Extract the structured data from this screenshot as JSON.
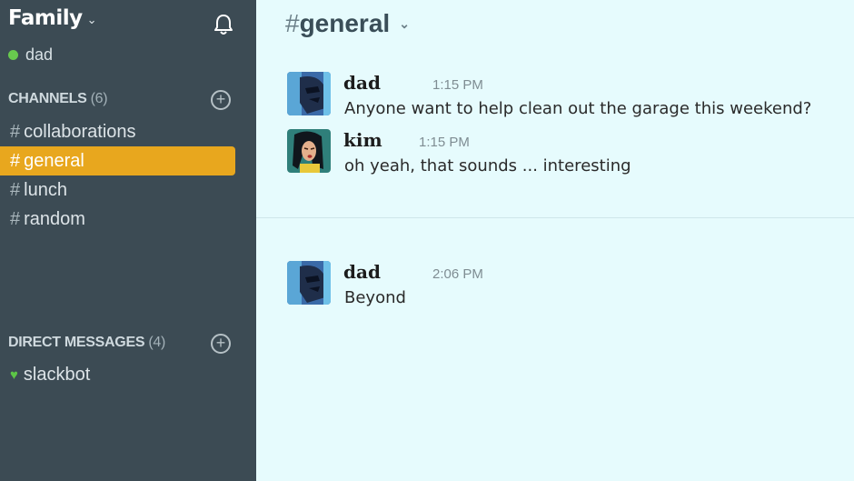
{
  "team": {
    "name": "Family",
    "chevron": "⌄"
  },
  "user": {
    "name": "dad",
    "status_color": "#68c94e"
  },
  "channels": {
    "heading": "CHANNELS",
    "count": "(6)",
    "items": [
      {
        "hash": "#",
        "label": "collaborations"
      },
      {
        "hash": "#",
        "label": "general",
        "active": true
      },
      {
        "hash": "#",
        "label": "lunch"
      },
      {
        "hash": "#",
        "label": "random"
      }
    ]
  },
  "direct_messages": {
    "heading": "DIRECT MESSAGES",
    "count": "(4)",
    "items": [
      {
        "icon": "heart-icon",
        "label": "slackbot"
      }
    ]
  },
  "main": {
    "channel_hash": "#",
    "channel_name": "general",
    "chevron": "⌄",
    "messages": [
      {
        "author": "dad",
        "time": "1:15 PM",
        "text": "Anyone want to help clean out the garage this weekend?"
      },
      {
        "author": "kim",
        "time": "1:15 PM",
        "text": "oh yeah, that sounds ... interesting"
      },
      {
        "author": "dad",
        "time": "2:06 PM",
        "text": "Beyond"
      }
    ]
  },
  "colors": {
    "sidebar": "#3c4b54",
    "active_channel": "#e8a71e",
    "main_bg": "#e6fbfd",
    "presence": "#68c94e"
  }
}
